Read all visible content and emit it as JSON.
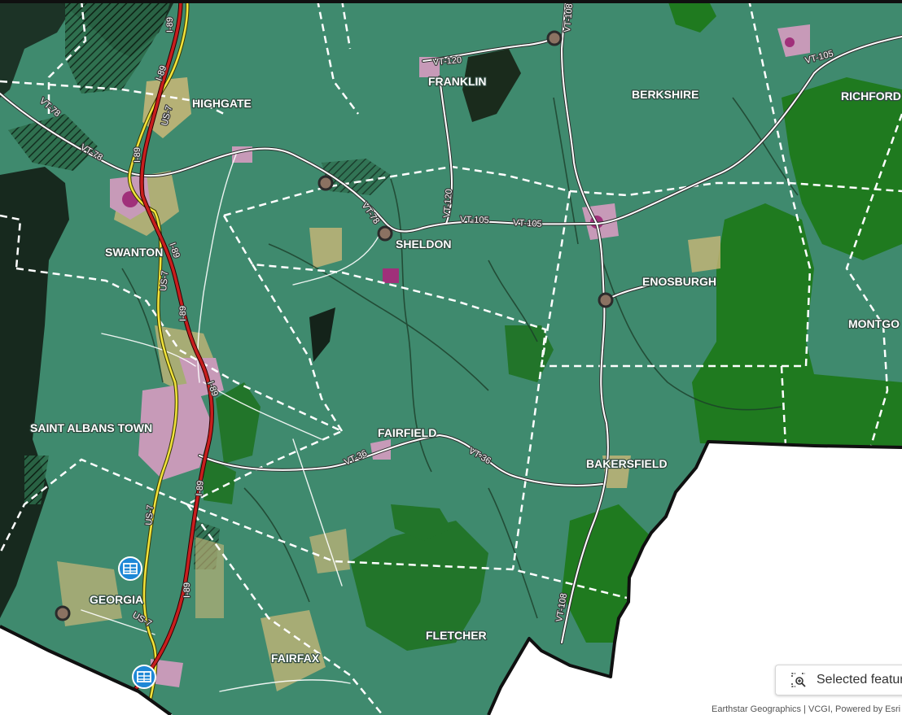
{
  "map": {
    "towns": [
      {
        "id": "highgate",
        "name": "HIGHGATE"
      },
      {
        "id": "franklin",
        "name": "FRANKLIN"
      },
      {
        "id": "berkshire",
        "name": "BERKSHIRE"
      },
      {
        "id": "richford",
        "name": "RICHFORD"
      },
      {
        "id": "swanton",
        "name": "SWANTON"
      },
      {
        "id": "sheldon",
        "name": "SHELDON"
      },
      {
        "id": "enosburgh",
        "name": "ENOSBURGH"
      },
      {
        "id": "montgomery",
        "name": "MONTGO"
      },
      {
        "id": "saint-albans-town",
        "name": "SAINT ALBANS TOWN"
      },
      {
        "id": "fairfield",
        "name": "FAIRFIELD"
      },
      {
        "id": "bakersfield",
        "name": "BAKERSFIELD"
      },
      {
        "id": "georgia",
        "name": "GEORGIA"
      },
      {
        "id": "fletcher",
        "name": "FLETCHER"
      },
      {
        "id": "fairfax",
        "name": "FAIRFAX"
      }
    ],
    "route_labels": {
      "i89_a": "I-89",
      "i89_b": "I-89",
      "i89_c": "I-89",
      "i89_d": "I-89",
      "i89_e": "I-89",
      "i89_f": "I-89",
      "i89_g": "I-89",
      "i89_h": "I-89",
      "us7_a": "US-7",
      "us7_b": "US-7",
      "us7_c": "US-7",
      "us7_d": "US-7",
      "vt78_a": "VT-78",
      "vt78_b": "VT-78",
      "vt78_c": "VT-78",
      "vt120_a": "VT-120",
      "vt120_b": "VT-120",
      "vt108_a": "VT-108",
      "vt108_b": "VT-108",
      "vt105_a": "VT-105",
      "vt105_b": "VT-105",
      "vt105_c": "VT-105",
      "vt36_a": "VT-36",
      "vt36_b": "VT-36"
    },
    "colors": {
      "land": "#3f8a6e",
      "forest": "#1f7a1f",
      "water": "#1c3326",
      "developed": "#cbb778",
      "urban": "#c79ab8",
      "urban_core": "#a0307a",
      "interstate": "#c81e1e",
      "us_highway": "#f2e33c",
      "boundary": "#ffffff",
      "outside": "#ffffff"
    },
    "markers": [
      {
        "id": "point-franklin-north",
        "icon": "circle-marker-icon"
      },
      {
        "id": "point-highgate-east",
        "icon": "circle-marker-icon"
      },
      {
        "id": "point-sheldon",
        "icon": "circle-marker-icon"
      },
      {
        "id": "point-enosburgh",
        "icon": "circle-marker-icon"
      },
      {
        "id": "point-georgia",
        "icon": "circle-marker-icon"
      },
      {
        "id": "facility-georgia",
        "icon": "facility-icon"
      },
      {
        "id": "facility-georgia-south",
        "icon": "facility-icon"
      }
    ]
  },
  "toolbar": {
    "selected_features_label": "Selected features",
    "selected_features_icon": "zoom-to-selection-icon"
  },
  "attribution": "Earthstar Geographics | VCGI, Powered by Esri"
}
